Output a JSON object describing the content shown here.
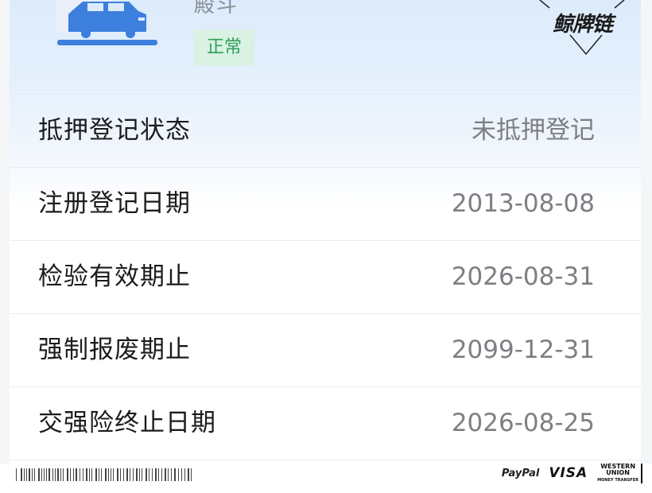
{
  "vehicle": {
    "subtitle": "殿斗",
    "status": "正常",
    "icon": "car-icon"
  },
  "watermark": {
    "text": "鲸牌链"
  },
  "details": [
    {
      "label": "抵押登记状态",
      "value": "未抵押登记"
    },
    {
      "label": "注册登记日期",
      "value": "2013-08-08"
    },
    {
      "label": "检验有效期止",
      "value": "2026-08-31"
    },
    {
      "label": "强制报废期止",
      "value": "2099-12-31"
    },
    {
      "label": "交强险终止日期",
      "value": "2026-08-25"
    }
  ],
  "footer": {
    "paypal": "PayPal",
    "visa": "VISA",
    "western_union_line1": "WESTERN",
    "western_union_line2": "UNION",
    "western_union_line3": "MONEY TRANSFER"
  },
  "colors": {
    "status_bg": "#d9f2e2",
    "status_text": "#2f9e5a",
    "car_blue": "#3d7fdc",
    "header_gradient_top": "#dcebfb"
  }
}
